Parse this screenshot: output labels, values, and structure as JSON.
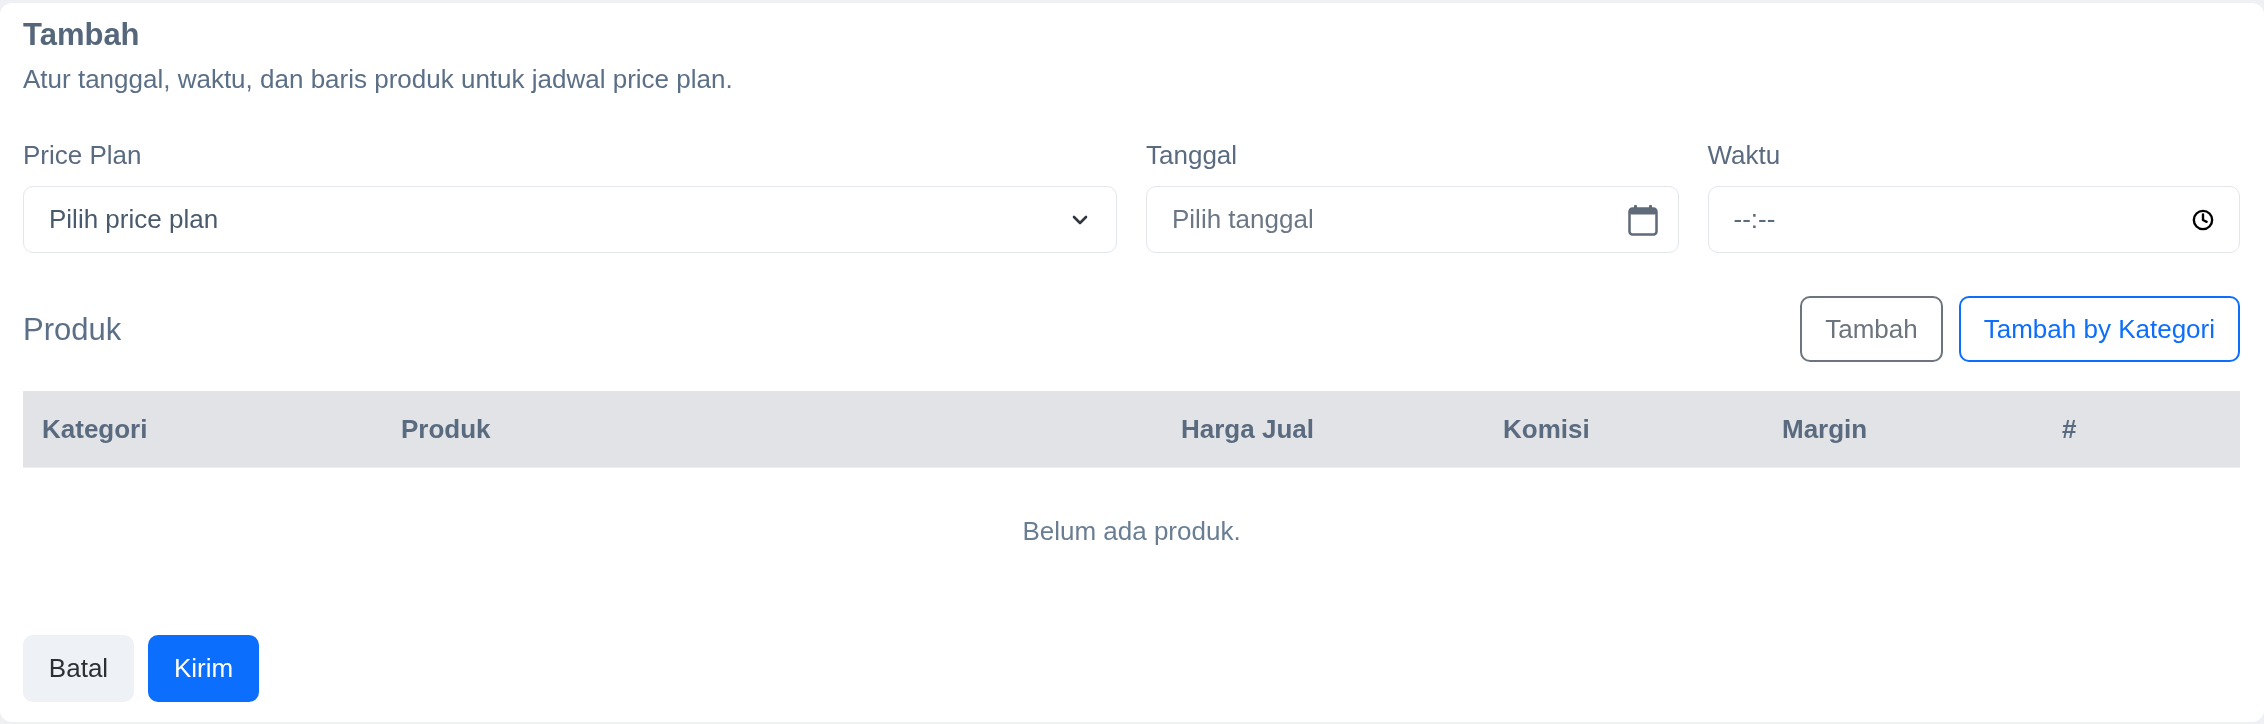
{
  "header": {
    "title": "Tambah",
    "subtitle": "Atur tanggal, waktu, dan baris produk untuk jadwal price plan."
  },
  "fields": [
    {
      "kind": "select",
      "label": "Price Plan",
      "placeholder": "Pilih price plan"
    },
    {
      "kind": "date",
      "label": "Tanggal",
      "placeholder": "Pilih tanggal"
    },
    {
      "kind": "time",
      "label": "Waktu",
      "placeholder": "--:--"
    }
  ],
  "products": {
    "title": "Produk",
    "actions": [
      {
        "kind": "secondary",
        "label": "Tambah"
      },
      {
        "kind": "primary",
        "label": "Tambah by Kategori"
      }
    ],
    "table": {
      "columns": [
        "Kategori",
        "Produk",
        "Harga Jual",
        "Komisi",
        "Margin",
        "#"
      ],
      "empty_message": "Belum ada produk."
    }
  },
  "footer_buttons": [
    {
      "kind": "light",
      "label": "Batal"
    },
    {
      "kind": "primary",
      "label": "Kirim"
    }
  ]
}
